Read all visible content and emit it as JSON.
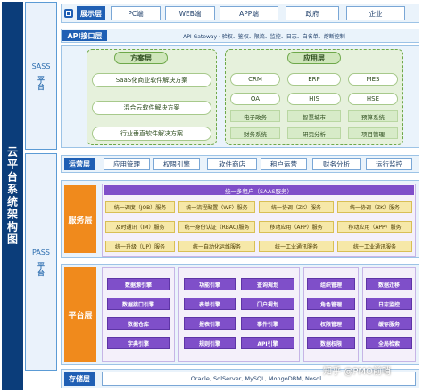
{
  "title": "云平台系统架构图",
  "side": {
    "saas": "SASS",
    "saas_sub": "平台",
    "pass": "PASS",
    "pass_sub": "平台"
  },
  "display_layer": {
    "label": "展示层",
    "items": [
      "PC端",
      "WEB端",
      "APP端",
      "政府",
      "企业"
    ]
  },
  "api_layer": {
    "label": "API接口层",
    "text": "API Gateway · 验权、鉴权、限流、监控、日志、白名单、熔断控制"
  },
  "solution_layer": {
    "title": "方案层",
    "items": [
      "SaaS化商业软件解决方案",
      "混合云软件解决方案",
      "行业垂直软件解决方案"
    ]
  },
  "application_layer": {
    "title": "应用层",
    "rows": [
      [
        "CRM",
        "ERP",
        "MES"
      ],
      [
        "OA",
        "HIS",
        "HSE"
      ],
      [
        "电子政务",
        "智慧城市",
        "预算系统"
      ],
      [
        "财务系统",
        "研究分析",
        "项目管理"
      ]
    ]
  },
  "ops_layer": {
    "label": "运营层",
    "items": [
      "应用管理",
      "权限引擎",
      "软件商店",
      "租户运营",
      "财务分析",
      "运行监控"
    ]
  },
  "service_layer": {
    "label": "服务层",
    "top": "统一多租户（SAAS服务）",
    "col1": [
      "统一调度（JOB）服务",
      "及时通讯（IM）服务",
      "统一升级（UP）服务"
    ],
    "col2": [
      "统一流程配置（WF）服务",
      "统一身份认证（RBAC)服务",
      "统一自动化运维服务"
    ],
    "col3": [
      "统一协调（ZK）服务",
      "移动应用（APP）服务",
      "统一工业通讯服务"
    ],
    "col4": [
      "统一协调（ZK）服务",
      "移动应用（APP）服务",
      "统一工业通讯服务"
    ]
  },
  "platform_layer": {
    "label": "平台层",
    "col1": [
      "数据源引擎",
      "数据接口引擎",
      "数据仓库",
      "字典引擎"
    ],
    "col2": [
      "功能引擎",
      "表单引擎",
      "报表引擎",
      "规则引擎"
    ],
    "col3": [
      "查询规划",
      "门户规划",
      "事件引擎",
      "API引擎"
    ],
    "col4": [
      "组织管理",
      "角色管理",
      "权限管理",
      "数据权限"
    ],
    "col5": [
      "数据迁移",
      "日志监控",
      "缓存服务",
      "全局检索"
    ]
  },
  "storage_layer": {
    "label": "存储层",
    "text": "Oracle, SqlServer, MySQL, MongoDBM, Nosql..."
  },
  "watermark": "知乎 @PMO前哨"
}
